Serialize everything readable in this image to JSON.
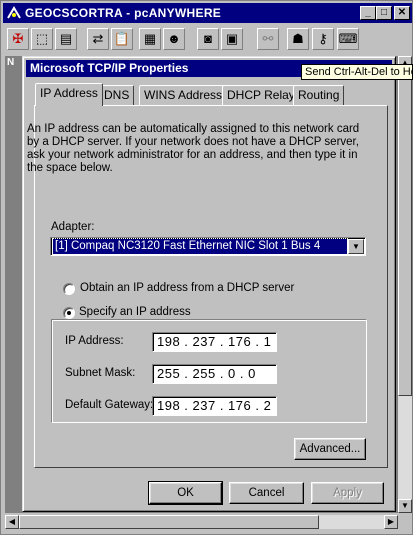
{
  "outer_window": {
    "title": "GEOCSCORTRA - pcANYWHERE",
    "minimize_glyph": "_",
    "maximize_glyph": "□",
    "close_glyph": "✕"
  },
  "toolbar": {
    "tools": [
      "remote-view-icon",
      "select-icon",
      "properties-icon",
      "transfer-icon",
      "clipboard-icon",
      "file-icon",
      "chat-icon",
      "record-icon",
      "save-icon",
      "link-icon",
      "users-icon",
      "keys-icon",
      "ctrl-alt-del-icon"
    ]
  },
  "tooltip": "Send Ctrl-Alt-Del to Ho",
  "dialog": {
    "title": "Microsoft TCP/IP Properties",
    "tabs": [
      {
        "label": "IP Address",
        "active": true
      },
      {
        "label": "DNS"
      },
      {
        "label": "WINS Address"
      },
      {
        "label": "DHCP Relay"
      },
      {
        "label": "Routing"
      }
    ],
    "description": "An IP address can be automatically assigned to this network card by a DHCP server.  If your network does not have a DHCP server, ask your network administrator for an address, and then type it in the space below.",
    "adapter_label": "Adapter:",
    "adapter_value": "[1] Compaq NC3120 Fast Ethernet NIC  Slot 1 Bus 4",
    "radio_dhcp": "Obtain an IP address from a DHCP server",
    "radio_specify": "Specify an IP address",
    "ip_label": "IP Address:",
    "ip_value": "198 . 237 . 176 . 1",
    "subnet_label": "Subnet Mask:",
    "subnet_value": "255 . 255 . 0 . 0",
    "gateway_label": "Default Gateway:",
    "gateway_value": "198 . 237 . 176 . 2",
    "advanced_button": "Advanced...",
    "ok_button": "OK",
    "cancel_button": "Cancel",
    "apply_button": "Apply"
  }
}
